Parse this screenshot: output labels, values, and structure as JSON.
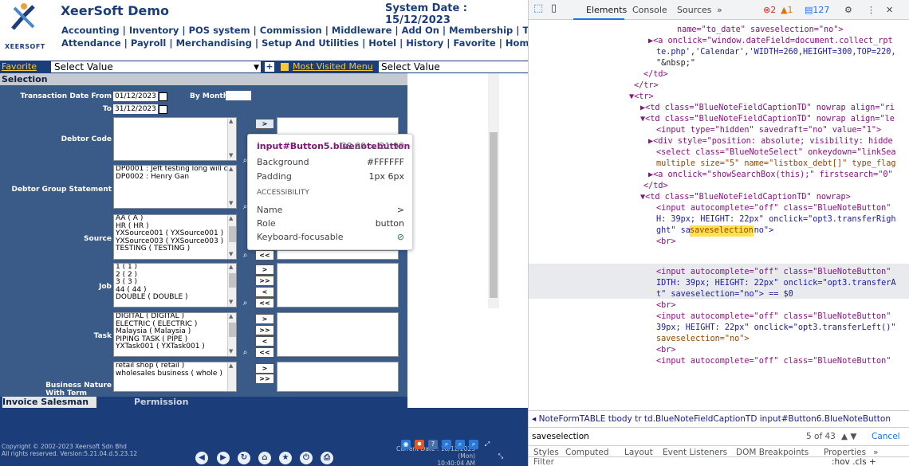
{
  "app": {
    "title": "XeerSoft Demo",
    "brand": "XEERSOFT",
    "system_date": "System Date : 15/12/2023",
    "nav_row1": "Accounting | Inventory | POS system | Commission | Middleware | Add On | Membership | Time",
    "nav_row2": "Attendance | Payroll | Merchandising | Setup And Utilities | Hotel | History | Favorite | Home",
    "favorite_label": "Favorite",
    "favorite_value": "Select Value",
    "most_visited_label": "Most Visited Menu",
    "most_visited_value": "Select Value"
  },
  "form": {
    "section": "Selection",
    "date_from_label": "Transaction Date From",
    "date_from": "01/12/2023",
    "to_label": "To",
    "date_to": "31/12/2023",
    "by_month_label": "By Month",
    "debtor_code_label": "Debtor Code",
    "debtor_group_label": "Debtor Group Statement",
    "debtor_group_items": [
      "DP0001 : Jeft testing long will c",
      "DP0002 : Henry Gan"
    ],
    "source_label": "Source",
    "source_items": [
      "AA ( A )",
      "HR ( HR )",
      "YXSource001 ( YXSource001 )",
      "YXSource003 ( YXSource003 )",
      "TESTING ( TESTING )"
    ],
    "job_label": "Job",
    "job_items": [
      "1 ( 1 )",
      "2 ( 2 )",
      "3 ( 3 )",
      "44 ( 44 )",
      "DOUBLE ( DOUBLE )"
    ],
    "task_label": "Task",
    "task_items": [
      "DIGITAL ( DIGITAL )",
      "ELECTRIC ( ELECTRIC )",
      "Malaysia ( Malaysia )",
      "PIPING TASK ( PIPE )",
      "YXTask001 ( YXTask001 )"
    ],
    "business_label": "Business Nature",
    "business_items": [
      "retail shop ( retail )",
      "wholesales business ( whole )"
    ],
    "with_term_label": "With Term",
    "btn_right": ">",
    "btn_all_right": ">>",
    "btn_left": "<",
    "btn_all_left": "<<"
  },
  "tabs": {
    "invoice": "Invoice Salesman",
    "permission": "Permission"
  },
  "footer": {
    "copyright1": "Copyright © 2002-2023 Xeersoft Sdn Bhd",
    "copyright2": "All rights reserved. Version:5.21.04.d.5.23.12",
    "current_date": "Current Date : 18/12/2023 (Mon)",
    "current_time": "10:40:04 AM"
  },
  "tooltip": {
    "selector": "input#Button5.bluenotebutton",
    "size": "38.99 × 21.99",
    "background_label": "Background",
    "background_value": "#FFFFFF",
    "padding_label": "Padding",
    "padding_value": "1px 6px",
    "accessibility": "ACCESSIBILITY",
    "name_label": "Name",
    "name_value": ">",
    "role_label": "Role",
    "role_value": "button",
    "kb_label": "Keyboard-focusable"
  },
  "devtools": {
    "tabs": [
      "Elements",
      "Console",
      "Sources",
      "»"
    ],
    "errors": "2",
    "warnings": "1",
    "messages": "127",
    "code_lines": [
      "name=\"to_date\" saveselection=\"no\">",
      "▶<a onclick=\"window.dateField=document.collect_rpt",
      "te.php','Calendar','WIDTH=260,HEIGHT=300,TOP=220,",
      "\"&nbsp;\"",
      "</td>",
      "</tr>",
      "▼<tr>",
      "▶<td class=\"BlueNoteFieldCaptionTD\" nowrap align=\"ri",
      "▼<td class=\"BlueNoteFieldCaptionTD\" nowrap align=\"le",
      "<input type=\"hidden\" savedraft=\"no\" value=\"1\">",
      "▶<div style=\"position: absolute; visibility: hidde",
      "<select class=\"BlueNoteSelect\" onkeydown=\"linkSea",
      "multiple size=\"5\" name=\"listbox_debt[]\" type_flag",
      "▶<a onclick=\"showSearchBox(this);\" firstsearch=\"0\"",
      "</td>",
      "▼<td class=\"BlueNoteFieldCaptionTD\" nowrap>",
      "<input autocomplete=\"off\" class=\"BlueNoteButton\"",
      "H: 39px; HEIGHT: 22px\" onclick=\"opt3.transferRigh",
      "ght\" saveselection=\"no\">",
      "<br>",
      "<input autocomplete=\"off\" class=\"BlueNoteButton\"",
      "IDTH: 39px; HEIGHT: 22px\" onclick=\"opt3.transferA",
      "t\" saveselection=\"no\"> == $0",
      "<br>",
      "<input autocomplete=\"off\" class=\"BlueNoteButton\"",
      "39px; HEIGHT: 22px\" onclick=\"opt3.transferLeft()\"",
      "saveselection=\"no\">",
      "<br>",
      "<input autocomplete=\"off\" class=\"BlueNoteButton\""
    ],
    "highlight_word": "saveselection",
    "breadcrumbs": "◂ NoteFormTABLE  tbody  tr  td.BlueNoteFieldCaptionTD  input#Button6.BlueNoteButton",
    "search_value": "saveselection",
    "search_count": "5 of 43",
    "cancel": "Cancel",
    "style_tabs": [
      "Styles",
      "Computed",
      "Layout",
      "Event Listeners",
      "DOM Breakpoints",
      "Properties",
      "»"
    ],
    "filter_placeholder": "Filter",
    "filter_tools": ":hov  .cls  +"
  }
}
